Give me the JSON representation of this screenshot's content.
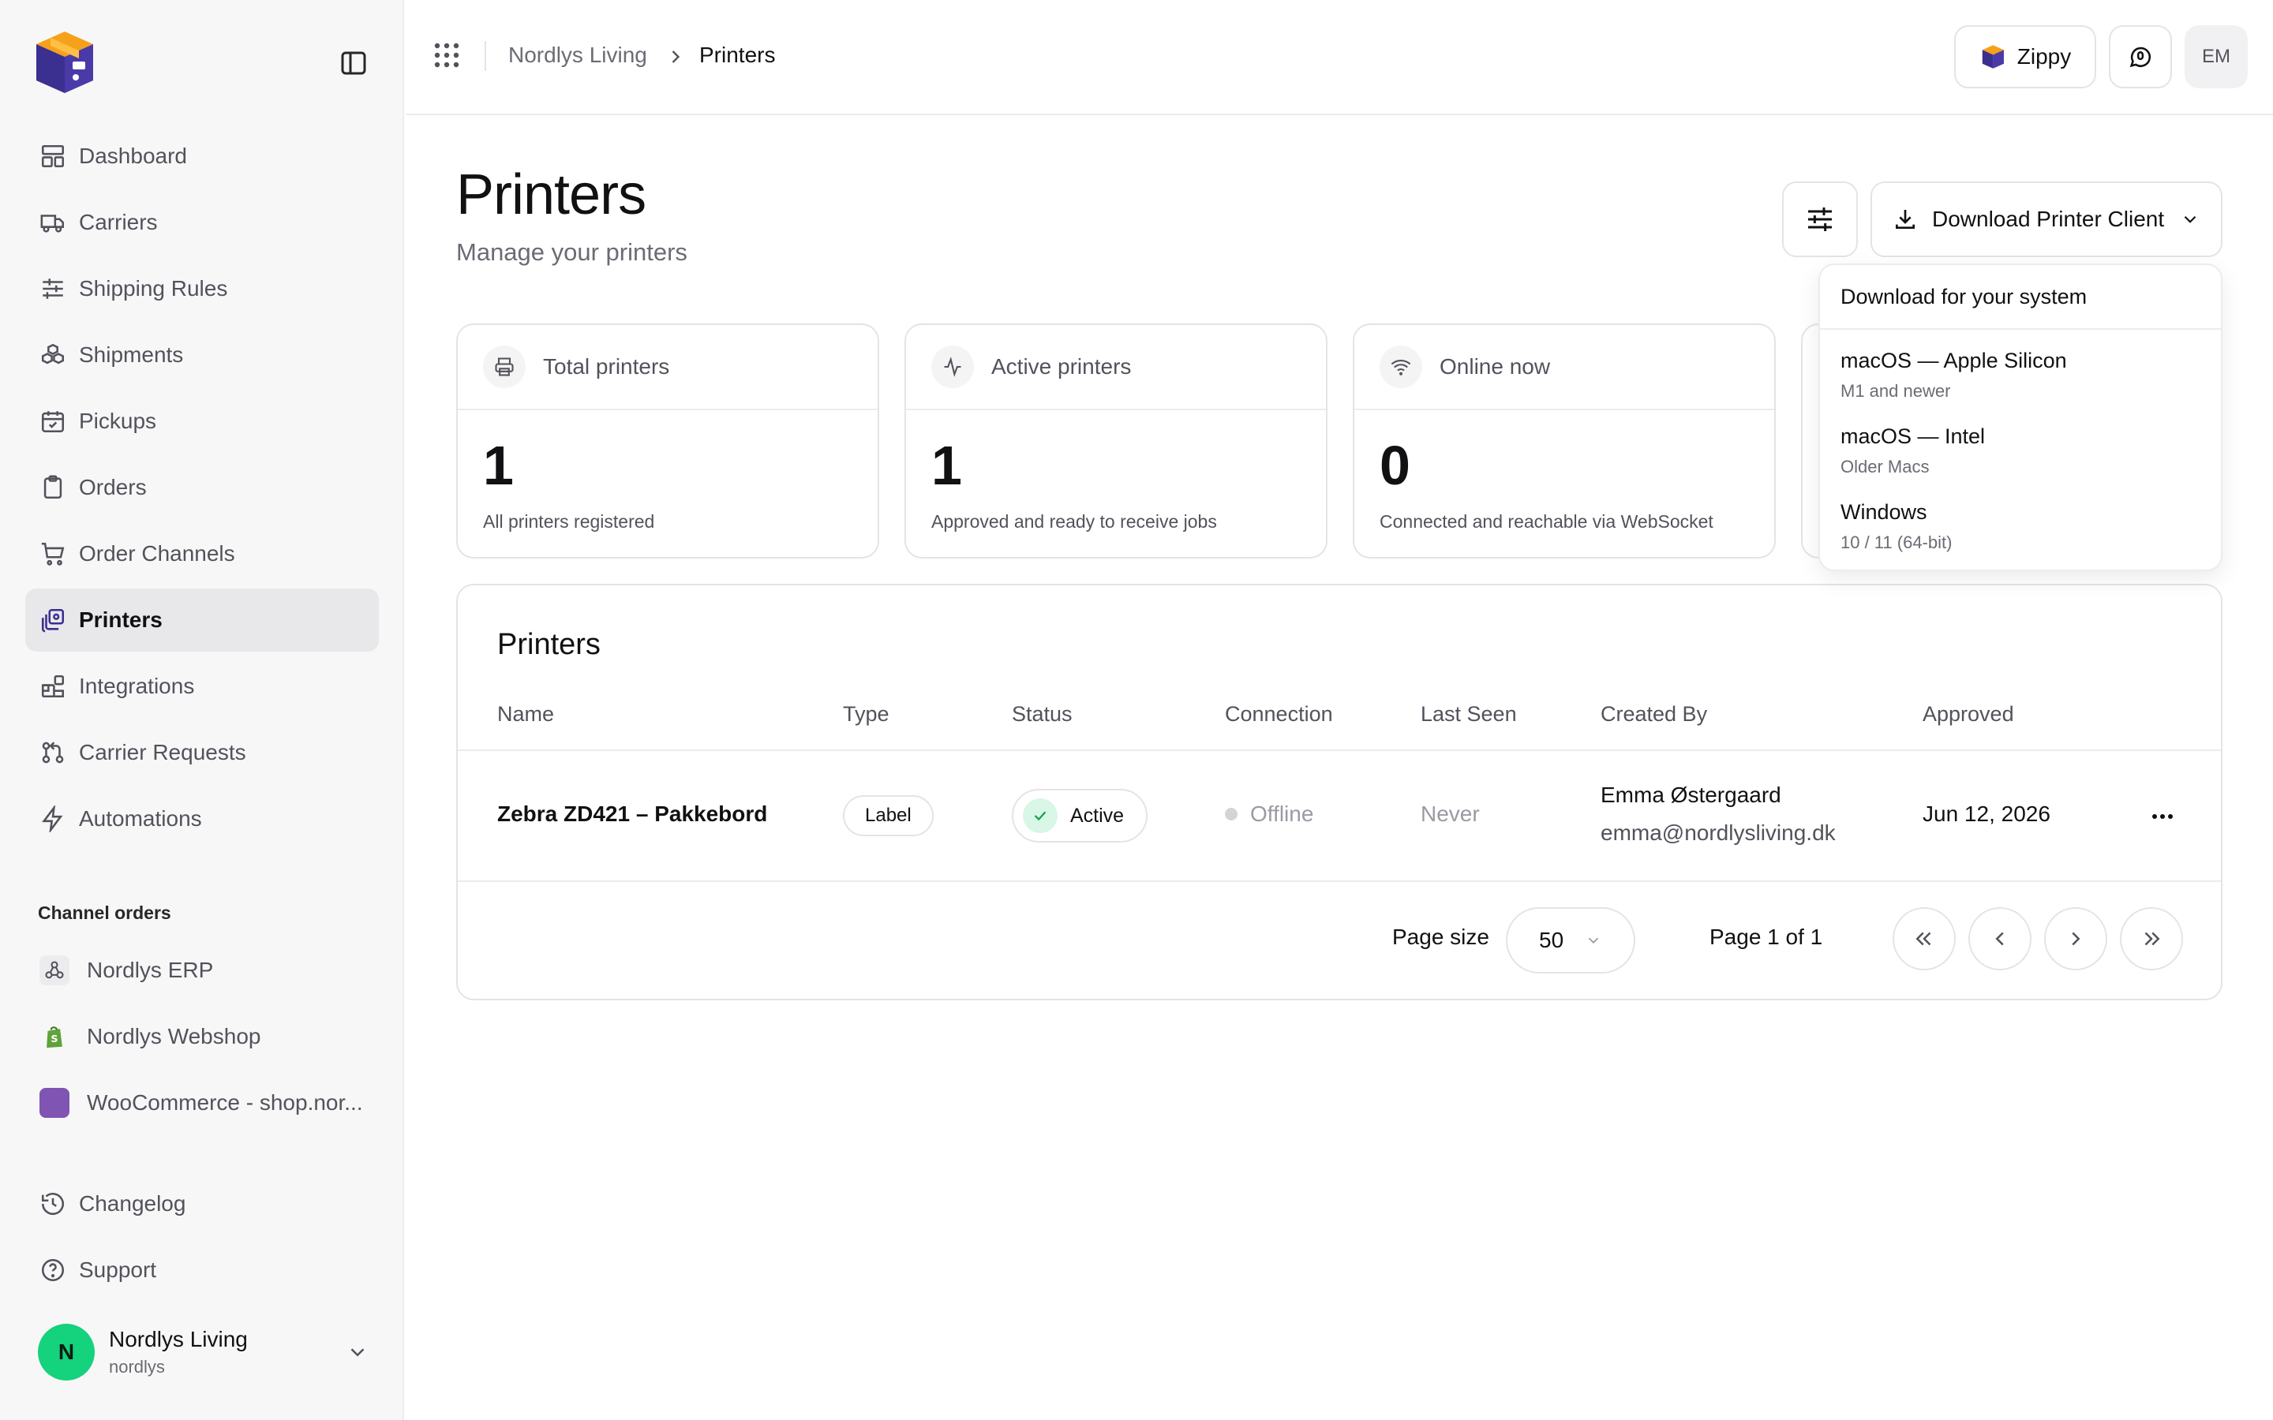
{
  "breadcrumb": {
    "org": "Nordlys Living",
    "current": "Printers"
  },
  "header": {
    "zippy_label": "Zippy",
    "user_initials": "EM"
  },
  "sidebar": {
    "nav": [
      {
        "label": "Dashboard",
        "icon": "dashboard-icon"
      },
      {
        "label": "Carriers",
        "icon": "truck-icon"
      },
      {
        "label": "Shipping Rules",
        "icon": "sliders-icon"
      },
      {
        "label": "Shipments",
        "icon": "boxes-icon"
      },
      {
        "label": "Pickups",
        "icon": "calendar-check-icon"
      },
      {
        "label": "Orders",
        "icon": "clipboard-icon"
      },
      {
        "label": "Order Channels",
        "icon": "cart-icon"
      },
      {
        "label": "Printers",
        "icon": "printers-icon",
        "active": true
      },
      {
        "label": "Integrations",
        "icon": "blocks-icon"
      },
      {
        "label": "Carrier Requests",
        "icon": "git-pull-icon"
      },
      {
        "label": "Automations",
        "icon": "zap-icon"
      }
    ],
    "channels_label": "Channel orders",
    "channels": [
      {
        "label": "Nordlys ERP",
        "icon": "webhook-icon"
      },
      {
        "label": "Nordlys Webshop",
        "icon": "shopify-icon"
      },
      {
        "label": "WooCommerce - shop.nor...",
        "icon": "woocommerce-icon"
      }
    ],
    "bottom": [
      {
        "label": "Changelog",
        "icon": "history-icon"
      },
      {
        "label": "Support",
        "icon": "help-circle-icon"
      }
    ],
    "org": {
      "initial": "N",
      "name": "Nordlys Living",
      "slug": "nordlys"
    }
  },
  "page": {
    "title": "Printers",
    "subtitle": "Manage your printers",
    "download_label": "Download Printer Client"
  },
  "stats": [
    {
      "label": "Total printers",
      "value": "1",
      "desc": "All printers registered",
      "icon": "printer-icon"
    },
    {
      "label": "Active printers",
      "value": "1",
      "desc": "Approved and ready to receive jobs",
      "icon": "activity-icon"
    },
    {
      "label": "Online now",
      "value": "0",
      "desc": "Connected and reachable via WebSocket",
      "icon": "wifi-icon"
    }
  ],
  "table": {
    "title": "Printers",
    "columns": [
      "Name",
      "Type",
      "Status",
      "Connection",
      "Last Seen",
      "Created By",
      "Approved"
    ],
    "rows": [
      {
        "name": "Zebra ZD421 – Pakkebord",
        "type": "Label",
        "status": "Active",
        "connection": "Offline",
        "last_seen": "Never",
        "created_by_name": "Emma Østergaard",
        "created_by_email": "emma@nordlysliving.dk",
        "approved": "Jun 12, 2026"
      }
    ]
  },
  "pagination": {
    "page_size_label": "Page size",
    "page_size": "50",
    "page_info": "Page 1 of 1"
  },
  "dropdown": {
    "title": "Download for your system",
    "items": [
      {
        "title": "macOS — Apple Silicon",
        "subtitle": "M1 and newer"
      },
      {
        "title": "macOS — Intel",
        "subtitle": "Older Macs"
      },
      {
        "title": "Windows",
        "subtitle": "10 / 11 (64-bit)"
      }
    ]
  },
  "colors": {
    "accent_green": "#15d27c",
    "brand_purple": "#3b2f8f",
    "brand_orange": "#f6a11a"
  }
}
